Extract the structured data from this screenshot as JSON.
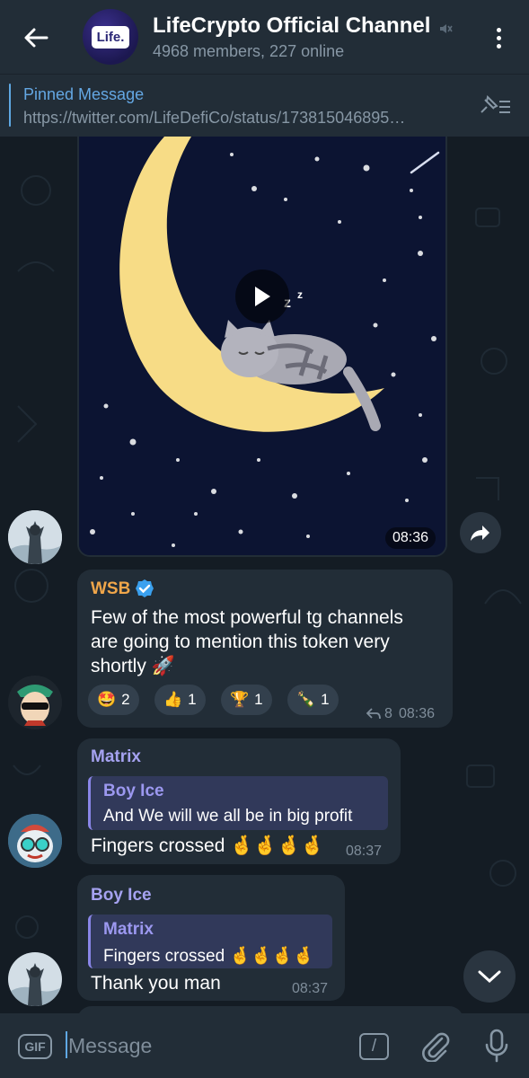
{
  "header": {
    "title": "LifeCrypto Official Channel",
    "subtitle": "4968 members, 227 online",
    "avatar_text": "Life."
  },
  "pinned": {
    "title": "Pinned Message",
    "text": "https://twitter.com/LifeDefiCo/status/173815046895…"
  },
  "video_message": {
    "time": "08:36"
  },
  "messages": [
    {
      "sender": "WSB",
      "verified": true,
      "text_lines": [
        "Few of the most powerful tg channels",
        "are going to mention this token very",
        "shortly 🚀"
      ],
      "reactions": [
        {
          "emoji": "🤩",
          "count": "2"
        },
        {
          "emoji": "👍",
          "count": "1"
        },
        {
          "emoji": "🏆",
          "count": "1"
        },
        {
          "emoji": "🍾",
          "count": "1"
        }
      ],
      "replies": "8",
      "time": "08:36"
    },
    {
      "sender": "Matrix",
      "quote": {
        "name": "Boy Ice",
        "text": "And We will we all be in big profit"
      },
      "text": "Fingers crossed 🤞🤞🤞🤞",
      "time": "08:37"
    },
    {
      "sender": "Boy Ice",
      "quote": {
        "name": "Matrix",
        "text": "Fingers crossed 🤞🤞🤞🤞"
      },
      "text": "Thank you man",
      "time": "08:37"
    }
  ],
  "composer": {
    "gif_label": "GIF",
    "placeholder": "Message",
    "command_label": "/"
  },
  "colors": {
    "accent": "#5fa8e3",
    "wsb_name": "#f0a64a",
    "matrix_name": "#a5a2f0",
    "boyice_name": "#a5a2f0",
    "background": "#141c24",
    "bubble": "#222d37"
  }
}
